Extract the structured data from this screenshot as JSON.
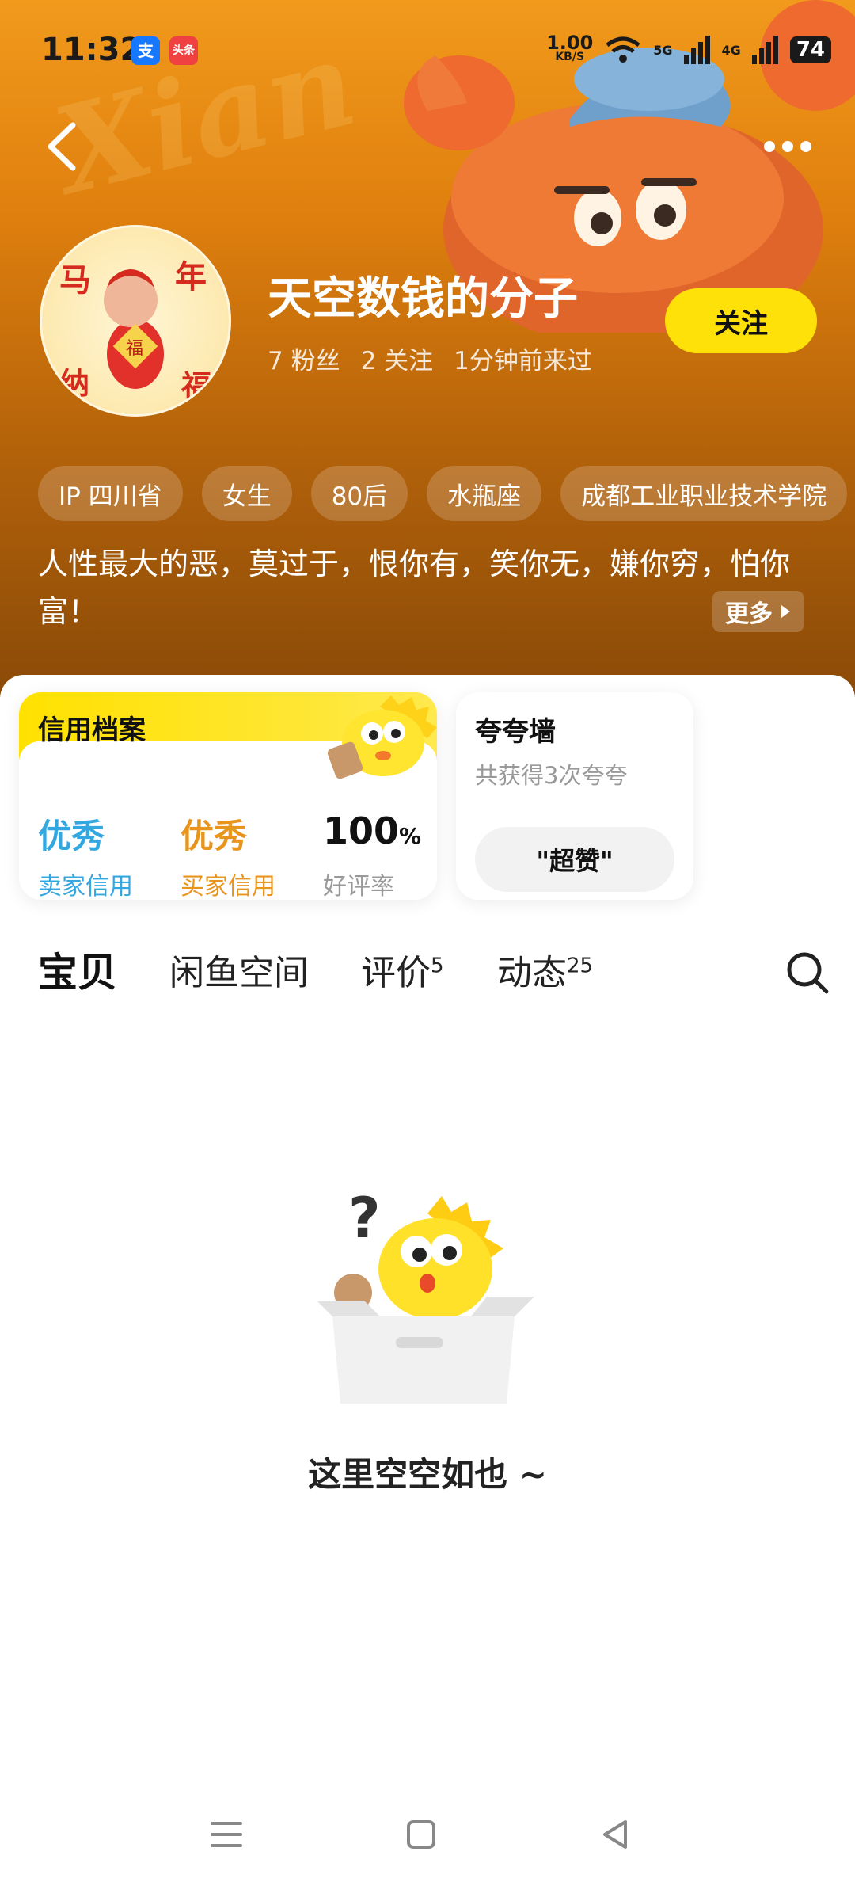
{
  "status_bar": {
    "time": "11:32",
    "app_badges": [
      "支",
      "头条"
    ],
    "net_speed_value": "1.00",
    "net_speed_unit": "KB/S",
    "sig1": "5G",
    "sig2": "4G",
    "battery": "74"
  },
  "header": {
    "watermark": "Xian",
    "back_icon": "chevron-left-icon",
    "more_icon": "more-dots-icon"
  },
  "profile": {
    "avatar_chars": [
      "马",
      "年",
      "纳",
      "福",
      "福"
    ],
    "nickname": "天空数钱的分子",
    "fans": "7 粉丝",
    "following": "2 关注",
    "last_seen": "1分钟前来过",
    "follow_label": "关注",
    "tags": [
      "IP 四川省",
      "女生",
      "80后",
      "水瓶座",
      "成都工业职业技术学院"
    ],
    "bio": "人性最大的恶，莫过于，恨你有，笑你无，嫌你穷，怕你富！",
    "more_label": "更多"
  },
  "credit": {
    "title": "信用档案",
    "seller_score": "优秀",
    "seller_label": "卖家信用",
    "buyer_score": "优秀",
    "buyer_label": "买家信用",
    "rate_value": "100",
    "rate_unit": "%",
    "rate_label": "好评率",
    "colors": {
      "seller": "#33a8e0",
      "buyer": "#e8951e"
    }
  },
  "praise": {
    "title": "夸夸墙",
    "subtitle": "共获得3次夸夸",
    "button": "\"超赞\""
  },
  "tabs": [
    {
      "label": "宝贝",
      "badge": ""
    },
    {
      "label": "闲鱼空间",
      "badge": ""
    },
    {
      "label": "评价",
      "badge": "5"
    },
    {
      "label": "动态",
      "badge": "25"
    }
  ],
  "empty_state": {
    "text": "这里空空如也 ~"
  },
  "nav": [
    "menu-icon",
    "home-square-icon",
    "back-triangle-icon"
  ],
  "accent": "#ffe10a"
}
